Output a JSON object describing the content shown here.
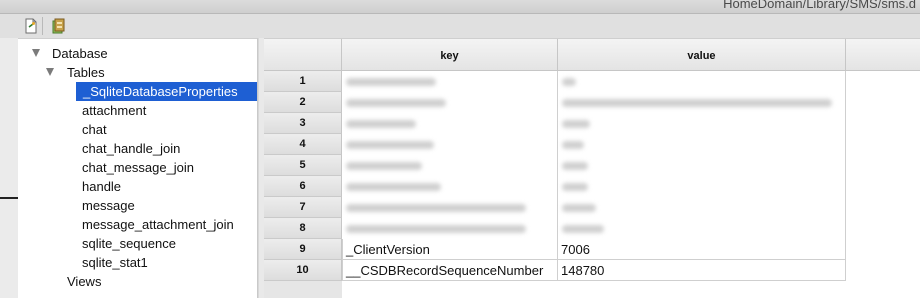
{
  "window": {
    "title": "HomeDomain/Library/SMS/sms.d"
  },
  "toolbar": {
    "buttons": [
      {
        "icon": "new-document-icon"
      },
      {
        "icon": "open-database-icon"
      }
    ]
  },
  "sidebar": {
    "root": {
      "label": "Database",
      "expanded": true
    },
    "tables_node": {
      "label": "Tables",
      "expanded": true
    },
    "tables": [
      {
        "label": "_SqliteDatabaseProperties",
        "selected": true
      },
      {
        "label": "attachment"
      },
      {
        "label": "chat"
      },
      {
        "label": "chat_handle_join"
      },
      {
        "label": "chat_message_join"
      },
      {
        "label": "handle"
      },
      {
        "label": "message"
      },
      {
        "label": "message_attachment_join"
      },
      {
        "label": "sqlite_sequence"
      },
      {
        "label": "sqlite_stat1"
      }
    ],
    "views_node": {
      "label": "Views"
    }
  },
  "grid": {
    "columns": {
      "key": "key",
      "value": "value"
    },
    "rows": [
      {
        "num": "1",
        "key": "",
        "value": "",
        "redacted": true
      },
      {
        "num": "2",
        "key": "",
        "value": "",
        "redacted": true
      },
      {
        "num": "3",
        "key": "",
        "value": "",
        "redacted": true
      },
      {
        "num": "4",
        "key": "",
        "value": "",
        "redacted": true
      },
      {
        "num": "5",
        "key": "",
        "value": "",
        "redacted": true
      },
      {
        "num": "6",
        "key": "",
        "value": "",
        "redacted": true
      },
      {
        "num": "7",
        "key": "",
        "value": "",
        "redacted": true
      },
      {
        "num": "8",
        "key": "",
        "value": "",
        "redacted": true
      },
      {
        "num": "9",
        "key": "_ClientVersion",
        "value": "7006",
        "redacted": false
      },
      {
        "num": "10",
        "key": "__CSDBRecordSequenceNumber",
        "value": "148780",
        "redacted": false
      }
    ]
  }
}
